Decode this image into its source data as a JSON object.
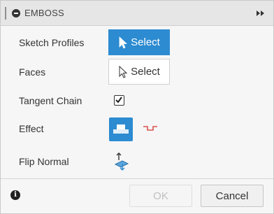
{
  "title": "EMBOSS",
  "rows": {
    "sketch_profiles": "Sketch Profiles",
    "faces": "Faces",
    "tangent_chain": "Tangent Chain",
    "effect": "Effect",
    "flip_normal": "Flip Normal"
  },
  "select_label": "Select",
  "tangent_chain_checked": true,
  "footer": {
    "ok_label": "OK",
    "cancel_label": "Cancel"
  },
  "colors": {
    "accent": "#2c8bd1",
    "effect_alt": "#d9534f"
  }
}
